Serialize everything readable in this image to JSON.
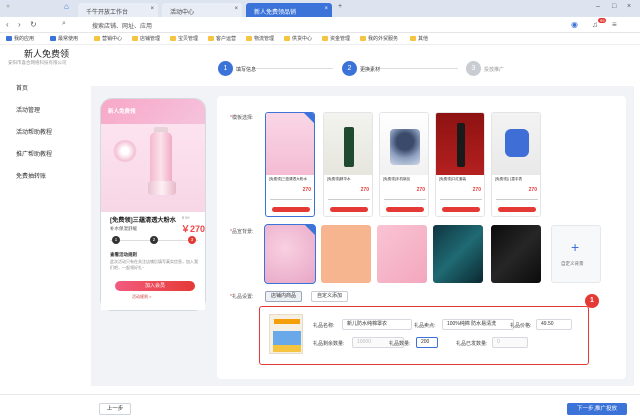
{
  "browser": {
    "tabs": [
      {
        "label": "千牛开放工作台"
      },
      {
        "label": "活动中心"
      },
      {
        "label": "新人免费领品销",
        "active": true
      }
    ],
    "address": "搜索店铺、网址、应用",
    "notification_count": "99",
    "bookmarks": [
      "我的应用",
      "最常使用",
      "营销中心",
      "店铺管理",
      "宝贝管理",
      "客户运营",
      "物流管理",
      "供货中心",
      "资金管理",
      "我的外贸服务",
      "其他"
    ]
  },
  "app": {
    "title": "新人免费领",
    "company": "安阳市喜合网络科技有限公司",
    "sidebar": [
      "首页",
      "活动管理",
      "活动帮助教程",
      "推广帮助教程",
      "免费抽转账"
    ]
  },
  "steps": [
    {
      "num": "1",
      "label": "填写信息",
      "active": true
    },
    {
      "num": "2",
      "label": "更换素材",
      "active": true
    },
    {
      "num": "3",
      "label": "投放推广",
      "active": false
    }
  ],
  "preview": {
    "header": "新人免费领",
    "title": "[免费领]三蕴清透大粉水",
    "subtitle": "补水保湿舒缓",
    "old_price": "￥99",
    "price": "￥270",
    "step_nums": [
      "1",
      "2",
      "3"
    ],
    "desc_title": "查看活动规则",
    "desc": "此次活动只有在关注店铺后填写真实信息，加入我们吧，一起领好礼~",
    "button": "加入会员",
    "link": "活动规则 >"
  },
  "form": {
    "template_label": "模板选择:",
    "background_label": "品宣背景:",
    "gift_label": "礼品设置:",
    "add_background": "自定义背景",
    "gift_tabs": [
      "店铺内商品",
      "自定义添加"
    ],
    "templates": [
      {
        "title": "[免费领]三蕴清透大粉水",
        "price": "270"
      },
      {
        "title": "[免费领]精华水",
        "price": "270"
      },
      {
        "title": "[免费领]手机新品",
        "price": "270"
      },
      {
        "title": "[免费领]口红套装",
        "price": "270"
      },
      {
        "title": "[免费领]儿童手表",
        "price": "270"
      }
    ]
  },
  "gift": {
    "name_label": "礼品名称:",
    "name_value": "新儿防水纯棉罩衣",
    "selling_label": "礼品卖点:",
    "selling_value": "100%纯棉 防水易清洗",
    "price_label": "礼品价格:",
    "price_value": "49.50",
    "stock_label": "礼品剩余数量:",
    "stock_value": "10000",
    "qty_label": "礼品数量:",
    "qty_value": "200",
    "received_label": "礼品已发数量:",
    "received_value": "0",
    "annotation": "1"
  },
  "footer": {
    "prev": "上一步",
    "next": "下一步,推广投放"
  }
}
